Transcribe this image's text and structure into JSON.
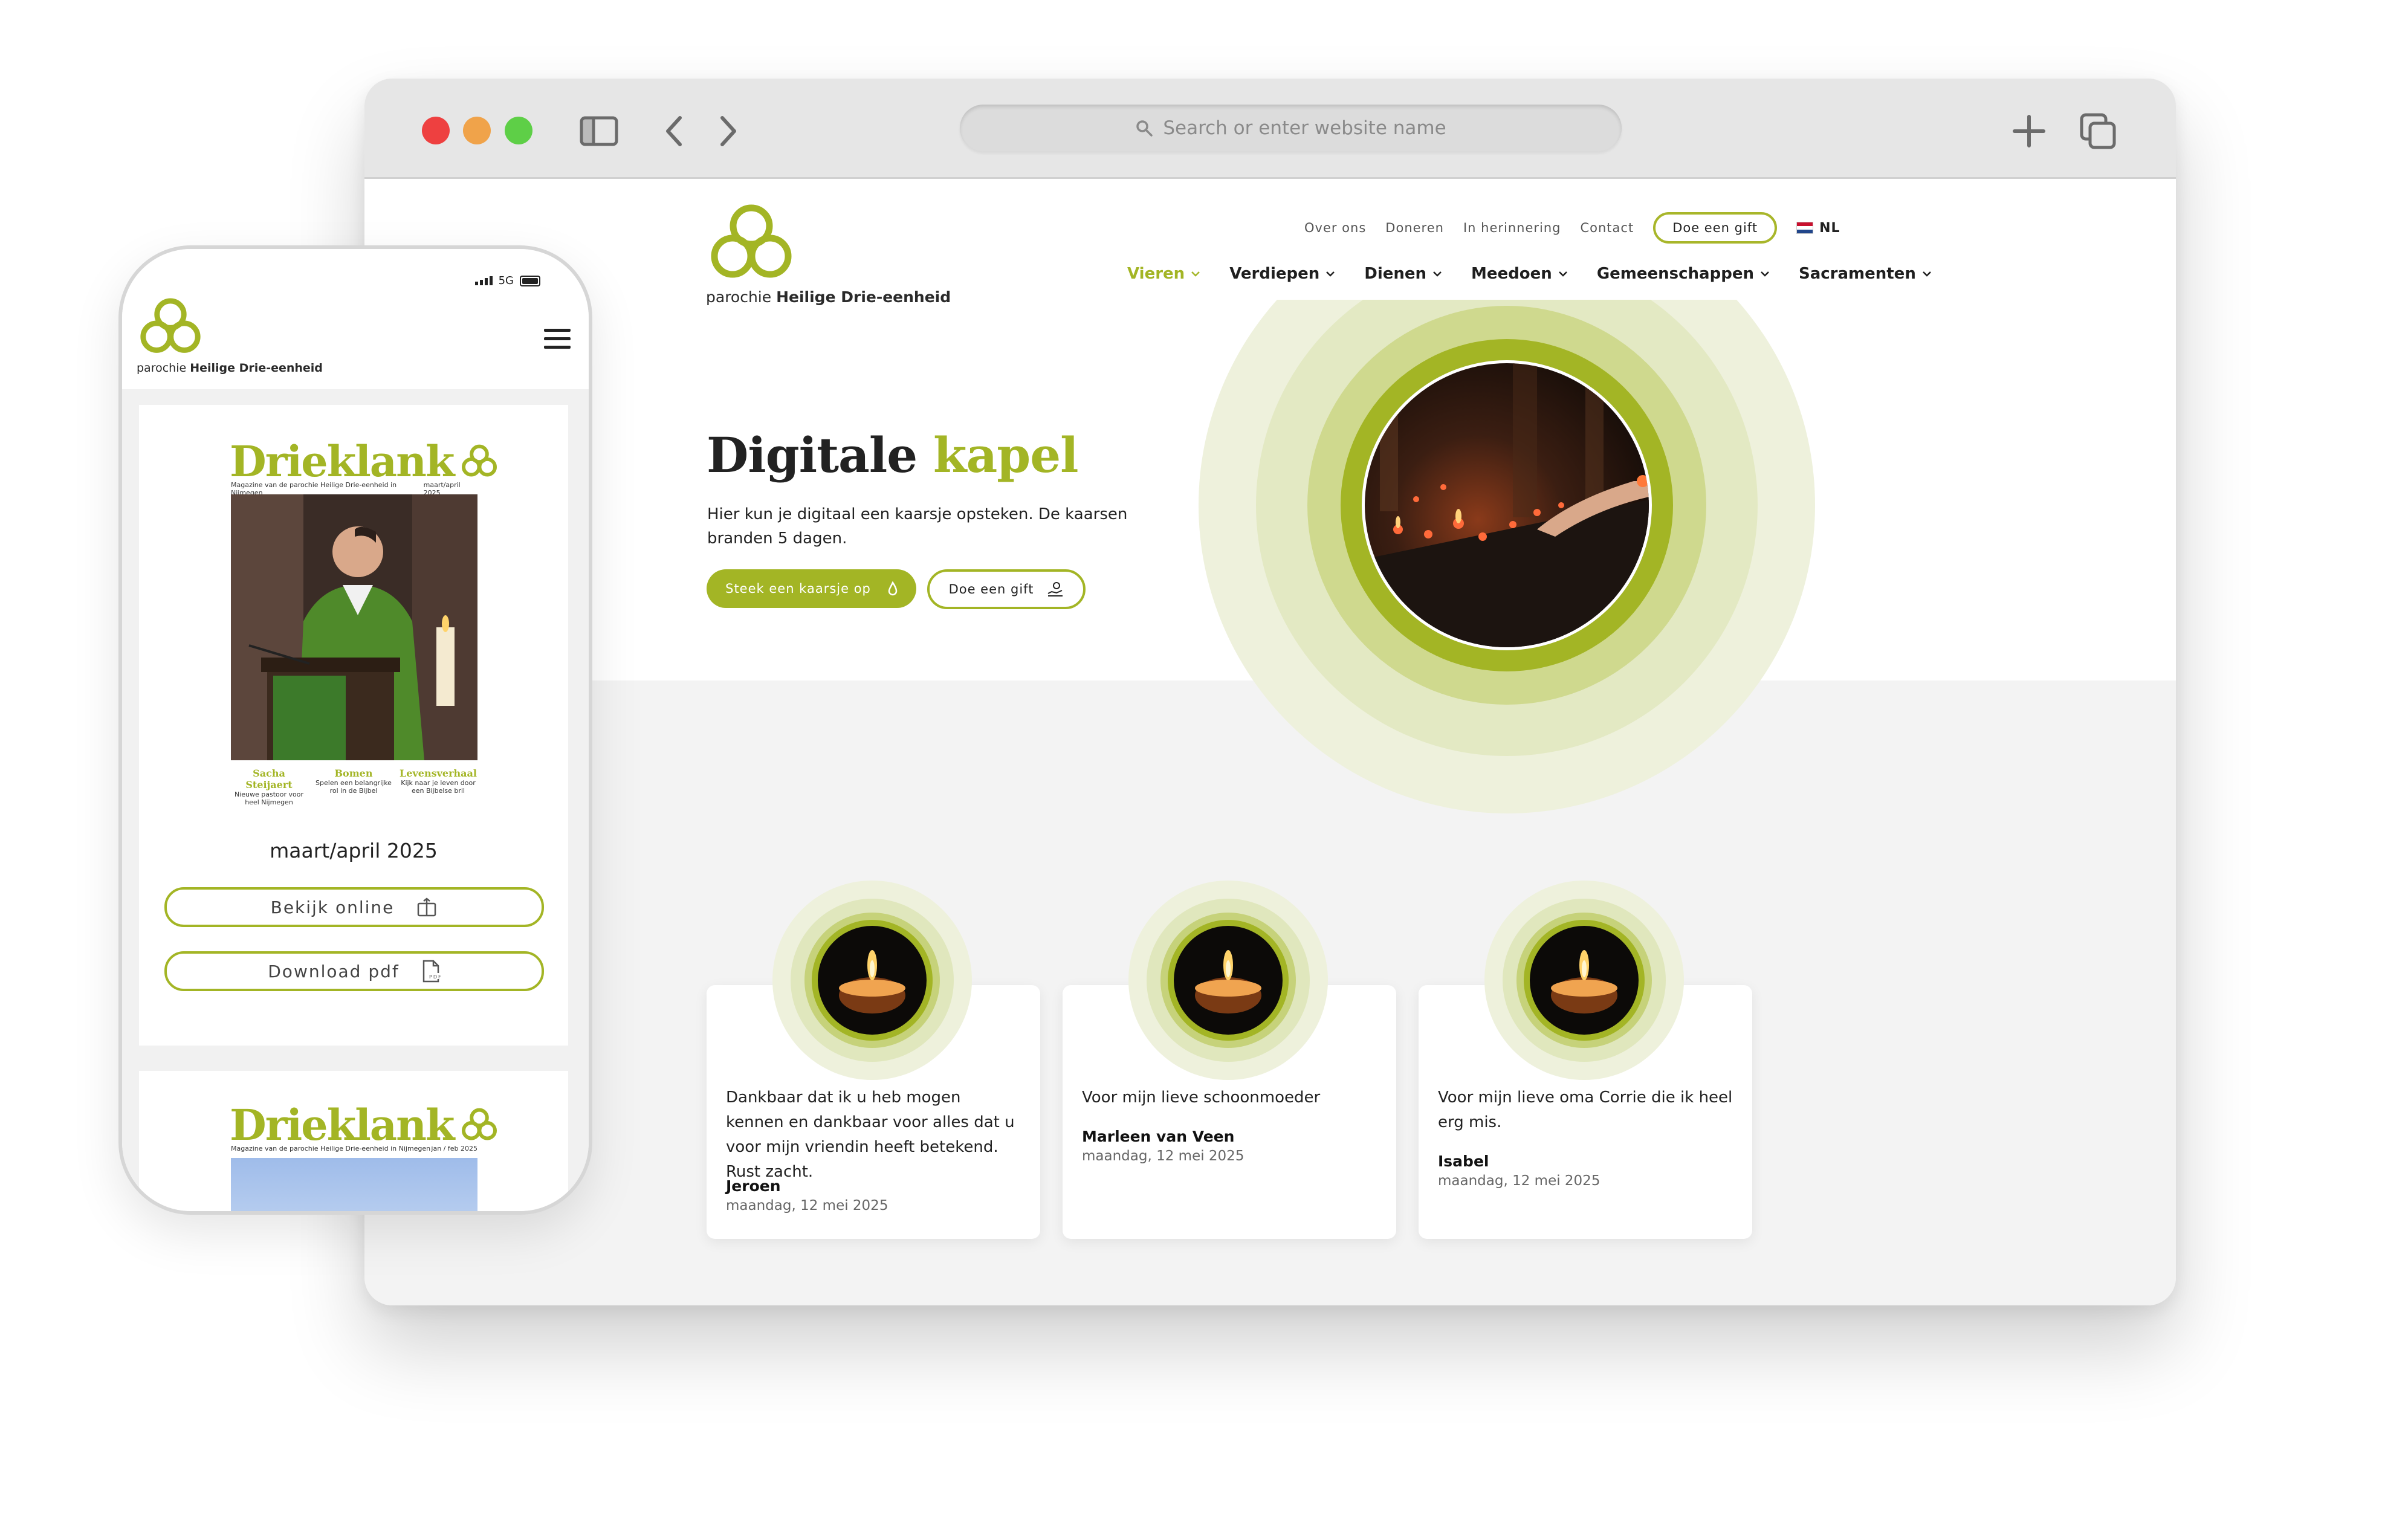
{
  "browser": {
    "url_placeholder": "Search or enter website name"
  },
  "site": {
    "logo": {
      "prefix": "parochie",
      "name": "Heilige Drie-eenheid"
    },
    "toplinks": [
      "Over ons",
      "Doneren",
      "In herinnering",
      "Contact"
    ],
    "gift_button": "Doe een gift",
    "language": "NL",
    "nav": [
      {
        "label": "Vieren",
        "active": true
      },
      {
        "label": "Verdiepen",
        "active": false
      },
      {
        "label": "Dienen",
        "active": false
      },
      {
        "label": "Meedoen",
        "active": false
      },
      {
        "label": "Gemeenschappen",
        "active": false
      },
      {
        "label": "Sacramenten",
        "active": false
      }
    ]
  },
  "hero": {
    "title_part1": "Digitale",
    "title_part2": "kapel",
    "subtitle": "Hier kun je digitaal een kaarsje opsteken. De kaarsen branden 5 dagen.",
    "primary_button": "Steek een kaarsje op",
    "secondary_button": "Doe een gift"
  },
  "candles": [
    {
      "message": "Dankbaar dat ik u heb mogen kennen en dankbaar voor alles dat u voor mijn vriendin heeft betekend. Rust zacht.",
      "name": "Jeroen",
      "date": "maandag, 12 mei 2025"
    },
    {
      "message": "Voor mijn lieve schoonmoeder",
      "name": "Marleen van Veen",
      "date": "maandag, 12 mei 2025"
    },
    {
      "message": "Voor mijn lieve oma Corrie die ik heel erg mis.",
      "name": "Isabel",
      "date": "maandag, 12 mei 2025"
    }
  ],
  "phone": {
    "network": "5G",
    "magazines": [
      {
        "title": "Drieklank",
        "subtitle": "Magazine van de parochie Heilige Drie-eenheid in Nijmegen",
        "issue": "maart/april 2025",
        "features": [
          {
            "head": "Sacha Steijaert",
            "text": "Nieuwe pastoor voor heel Nijmegen"
          },
          {
            "head": "Bomen",
            "text": "Spelen een belangrijke rol in de Bijbel"
          },
          {
            "head": "Levensverhaal",
            "text": "Kijk naar je leven door een Bijbelse bril"
          }
        ],
        "caption": "maart/april 2025",
        "view_button": "Bekijk online",
        "download_button": "Download pdf"
      },
      {
        "title": "Drieklank",
        "subtitle": "Magazine van de parochie Heilige Drie-eenheid in Nijmegen",
        "issue": "jan / feb 2025"
      }
    ]
  },
  "colors": {
    "accent": "#a3b525",
    "light_accent": "#e9eed0"
  }
}
